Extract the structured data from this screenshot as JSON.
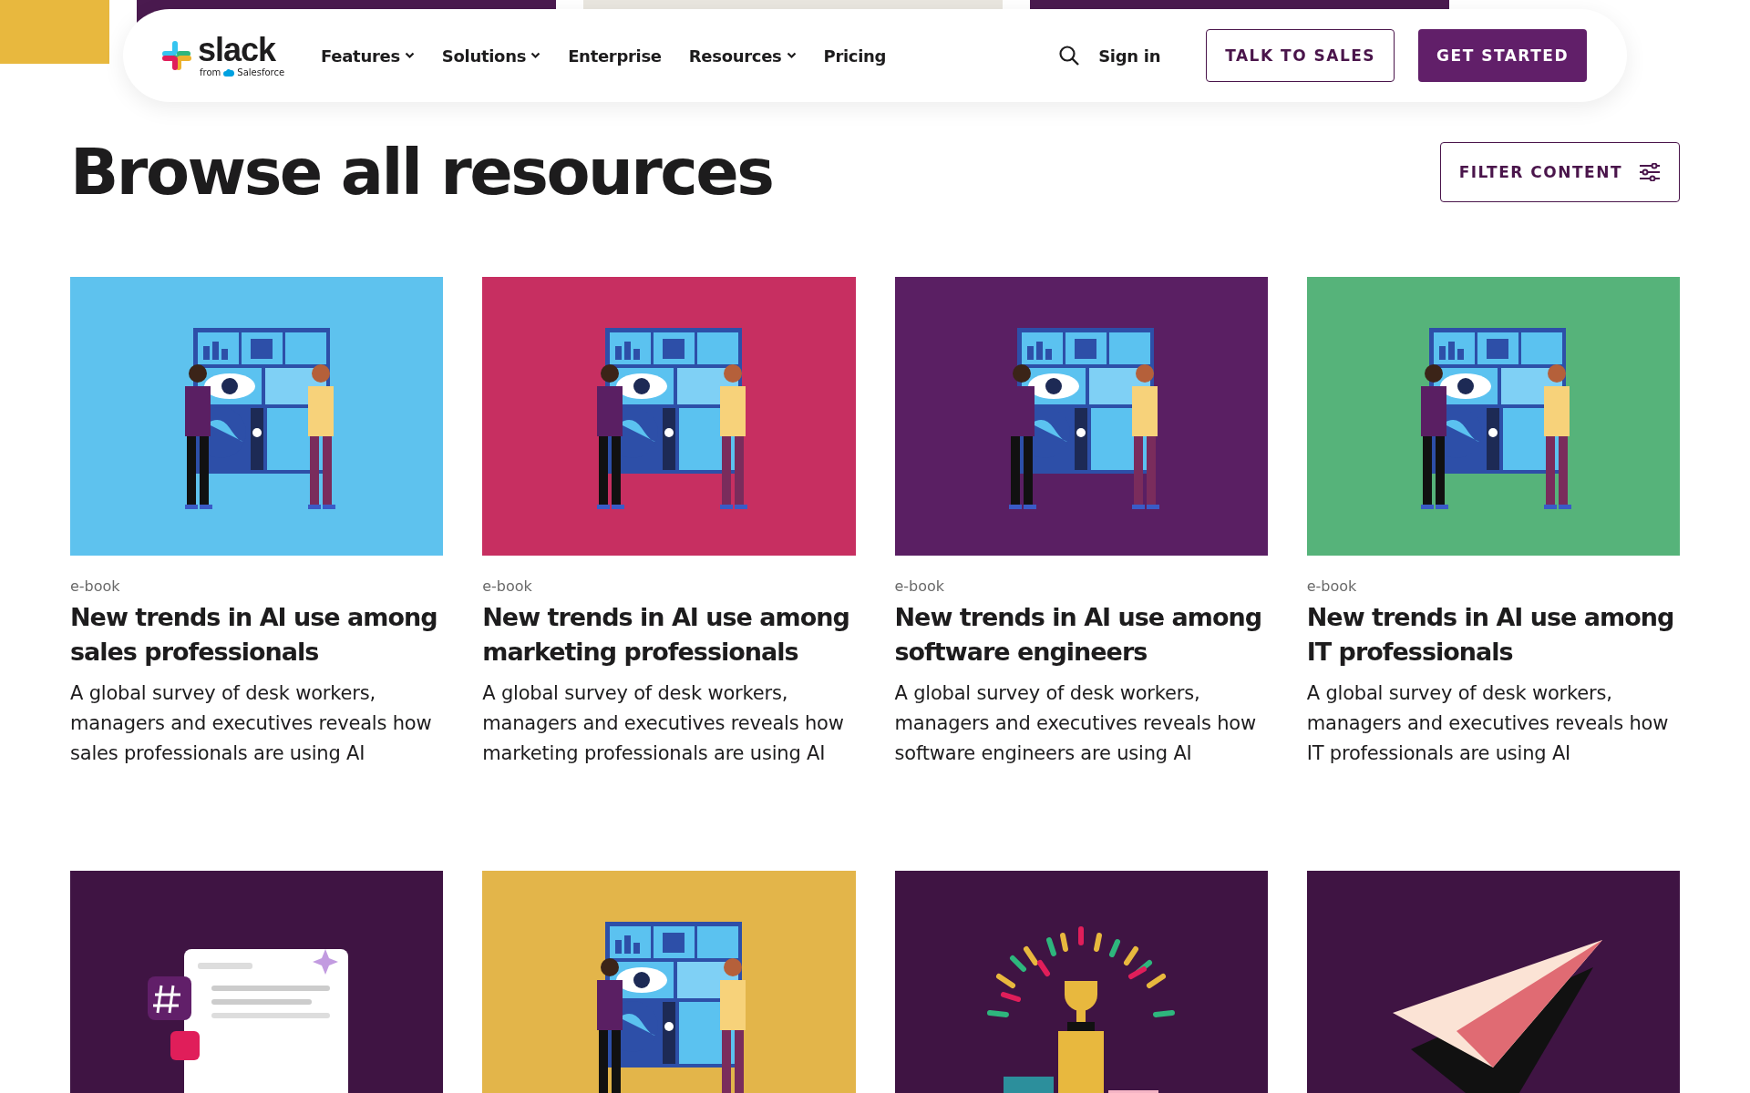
{
  "banner_images": [
    {
      "color": "#4a1a4f"
    },
    {
      "color": "#e9e6df"
    },
    {
      "color": "#4a1a4f"
    }
  ],
  "header": {
    "logo": {
      "wordmark": "slack",
      "tagline": "from",
      "partner": "Salesforce"
    },
    "nav": [
      {
        "label": "Features",
        "has_menu": true
      },
      {
        "label": "Solutions",
        "has_menu": true
      },
      {
        "label": "Enterprise",
        "has_menu": false
      },
      {
        "label": "Resources",
        "has_menu": true
      },
      {
        "label": "Pricing",
        "has_menu": false
      }
    ],
    "sign_in": "Sign in",
    "buttons": [
      {
        "label": "TALK TO SALES",
        "kind": "outline"
      },
      {
        "label": "GET STARTED",
        "kind": "filled"
      }
    ]
  },
  "page_title": "Browse all resources",
  "filter_button": "FILTER CONTENT",
  "cards": [
    {
      "kind": "people-dashboard",
      "color": "#5ec2ee",
      "category": "e-book",
      "title": "New trends in AI use among sales professionals",
      "description": "A global survey of desk workers, managers and executives reveals how sales professionals are using AI"
    },
    {
      "kind": "people-dashboard",
      "color": "#c72f61",
      "category": "e-book",
      "title": "New trends in AI use among marketing professionals",
      "description": "A global survey of desk workers, managers and executives reveals how marketing professionals are using AI"
    },
    {
      "kind": "people-dashboard",
      "color": "#5a1f63",
      "category": "e-book",
      "title": "New trends in AI use among software engineers",
      "description": "A global survey of desk workers, managers and executives reveals how software engineers are using AI"
    },
    {
      "kind": "people-dashboard",
      "color": "#56b37a",
      "category": "e-book",
      "title": "New trends in AI use among IT professionals",
      "description": "A global survey of desk workers, managers and executives reveals how IT professionals are using AI"
    },
    {
      "kind": "chat-window",
      "color": "#3f1443"
    },
    {
      "kind": "people-dashboard",
      "color": "#e3b54a"
    },
    {
      "kind": "trophy",
      "color": "#3f1443"
    },
    {
      "kind": "paper-plane",
      "color": "#3f1443"
    }
  ]
}
